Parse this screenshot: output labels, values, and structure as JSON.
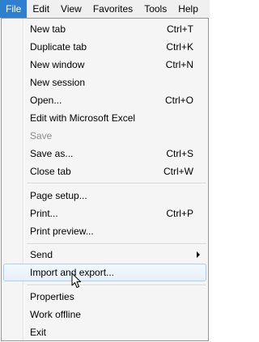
{
  "menubar": {
    "items": [
      {
        "label": "File"
      },
      {
        "label": "Edit"
      },
      {
        "label": "View"
      },
      {
        "label": "Favorites"
      },
      {
        "label": "Tools"
      },
      {
        "label": "Help"
      }
    ]
  },
  "file_menu": {
    "new_tab": {
      "label": "New tab",
      "shortcut": "Ctrl+T"
    },
    "duplicate_tab": {
      "label": "Duplicate tab",
      "shortcut": "Ctrl+K"
    },
    "new_window": {
      "label": "New window",
      "shortcut": "Ctrl+N"
    },
    "new_session": {
      "label": "New session"
    },
    "open": {
      "label": "Open...",
      "shortcut": "Ctrl+O"
    },
    "edit_with_excel": {
      "label": "Edit with Microsoft Excel"
    },
    "save": {
      "label": "Save"
    },
    "save_as": {
      "label": "Save as...",
      "shortcut": "Ctrl+S"
    },
    "close_tab": {
      "label": "Close tab",
      "shortcut": "Ctrl+W"
    },
    "page_setup": {
      "label": "Page setup..."
    },
    "print": {
      "label": "Print...",
      "shortcut": "Ctrl+P"
    },
    "print_preview": {
      "label": "Print preview..."
    },
    "send": {
      "label": "Send"
    },
    "import_export": {
      "label": "Import and export..."
    },
    "properties": {
      "label": "Properties"
    },
    "work_offline": {
      "label": "Work offline"
    },
    "exit": {
      "label": "Exit"
    }
  },
  "colors": {
    "menubar_bg": "#f0f0f0",
    "active_menu_bg": "#2f7fd1",
    "dropdown_bg": "#f5f5f5",
    "hover_border": "#aecdf0",
    "disabled_text": "#8d8d8d"
  },
  "icons": {
    "submenu_arrow": "chevron-right-icon",
    "mouse_cursor": "arrow-cursor-icon"
  }
}
